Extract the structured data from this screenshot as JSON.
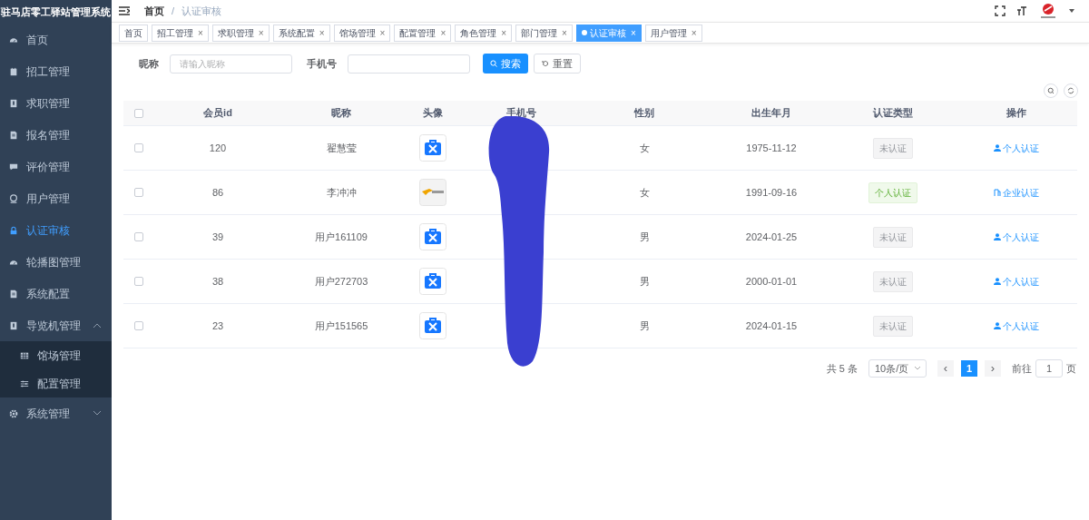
{
  "sidebar": {
    "title": "驻马店零工驿站管理系统",
    "items": [
      {
        "label": "首页",
        "selected": false
      },
      {
        "label": "招工管理",
        "selected": false
      },
      {
        "label": "求职管理",
        "selected": false
      },
      {
        "label": "报名管理",
        "selected": false
      },
      {
        "label": "评价管理",
        "selected": false
      },
      {
        "label": "用户管理",
        "selected": false
      },
      {
        "label": "认证审核",
        "selected": true
      },
      {
        "label": "轮播图管理",
        "selected": false
      },
      {
        "label": "系统配置",
        "selected": false
      },
      {
        "label": "导览机管理",
        "selected": false,
        "expanded": true,
        "children": [
          {
            "label": "馆场管理",
            "selected": false
          },
          {
            "label": "配置管理",
            "selected": false
          }
        ]
      },
      {
        "label": "系统管理",
        "selected": false,
        "expanded": false
      }
    ]
  },
  "breadcrumb": {
    "separator": "/",
    "items": [
      "首页",
      "认证审核"
    ]
  },
  "tags": [
    {
      "label": "首页",
      "selected": false
    },
    {
      "label": "招工管理",
      "close": "×",
      "selected": false
    },
    {
      "label": "求职管理",
      "close": "×",
      "selected": false
    },
    {
      "label": "系统配置",
      "close": "×",
      "selected": false
    },
    {
      "label": "馆场管理",
      "close": "×",
      "selected": false
    },
    {
      "label": "配置管理",
      "close": "×",
      "selected": false
    },
    {
      "label": "角色管理",
      "close": "×",
      "selected": false
    },
    {
      "label": "部门管理",
      "close": "×",
      "selected": false
    },
    {
      "label": "认证审核",
      "close": "×",
      "selected": true
    },
    {
      "label": "用户管理",
      "close": "×",
      "selected": false
    }
  ],
  "filters": [
    {
      "label": "昵称",
      "placeholder": "请输入昵称"
    },
    {
      "label": "手机号"
    }
  ],
  "buttons": {
    "search": "搜索",
    "reset": "重置"
  },
  "table": {
    "header_checked": false,
    "columns": [
      "会员id",
      "昵称",
      "头像",
      "手机号",
      "性别",
      "出生年月",
      "认证类型",
      "操作"
    ],
    "rows": [
      {
        "checked": false,
        "id": "120",
        "nickname": "翟慧莹",
        "avatar": {
          "kind": "app"
        },
        "gender": "女",
        "birth": "1975-11-12",
        "auth": {
          "label": "未认证",
          "kind": "none"
        },
        "action": {
          "label": "个人认证",
          "kind": "person"
        }
      },
      {
        "checked": false,
        "id": "86",
        "nickname": "李冲冲",
        "avatar": {
          "kind": "logo"
        },
        "gender": "女",
        "birth": "1991-09-16",
        "auth": {
          "label": "个人认证",
          "kind": "personal"
        },
        "action": {
          "label": "企业认证",
          "kind": "company"
        }
      },
      {
        "checked": false,
        "id": "39",
        "nickname": "用户161109",
        "avatar": {
          "kind": "app"
        },
        "gender": "男",
        "birth": "2024-01-25",
        "auth": {
          "label": "未认证",
          "kind": "none"
        },
        "action": {
          "label": "个人认证",
          "kind": "person"
        }
      },
      {
        "checked": false,
        "id": "38",
        "nickname": "用户272703",
        "avatar": {
          "kind": "app"
        },
        "gender": "男",
        "birth": "2000-01-01",
        "auth": {
          "label": "未认证",
          "kind": "none"
        },
        "action": {
          "label": "个人认证",
          "kind": "person"
        }
      },
      {
        "checked": false,
        "id": "23",
        "nickname": "用户151565",
        "avatar": {
          "kind": "app"
        },
        "gender": "男",
        "birth": "2024-01-15",
        "auth": {
          "label": "未认证",
          "kind": "none"
        },
        "action": {
          "label": "个人认证",
          "kind": "person"
        }
      }
    ]
  },
  "pagination": {
    "total": "共 5 条",
    "page_size": "10条/页",
    "prev": "‹",
    "next": "›",
    "pages": [
      {
        "label": "1",
        "selected": true
      }
    ],
    "goto_label": "前往",
    "goto_value": "1",
    "goto_suffix": "页"
  }
}
